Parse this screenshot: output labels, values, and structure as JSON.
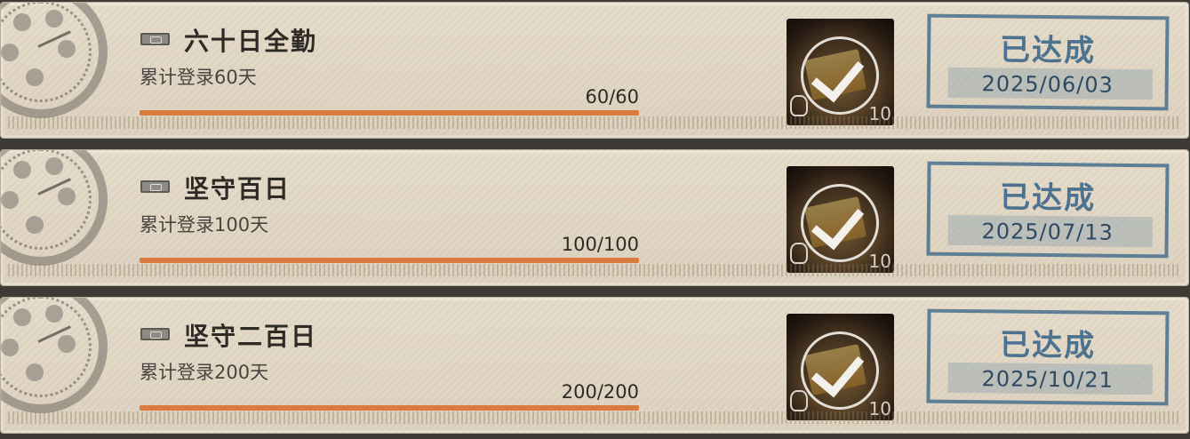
{
  "achievements": [
    {
      "title": "六十日全勤",
      "description": "累计登录60天",
      "progress_text": "60/60",
      "progress": 1.0,
      "reward_qty": "10",
      "status": "已达成",
      "date": "2025/06/03"
    },
    {
      "title": "坚守百日",
      "description": "累计登录100天",
      "progress_text": "100/100",
      "progress": 1.0,
      "reward_qty": "10",
      "status": "已达成",
      "date": "2025/07/13"
    },
    {
      "title": "坚守二百日",
      "description": "累计登录200天",
      "progress_text": "200/200",
      "progress": 1.0,
      "reward_qty": "10",
      "status": "已达成",
      "date": "2025/10/21"
    }
  ],
  "icons": {
    "badge": "clock-emblem-icon",
    "ticket": "ticket-icon",
    "reward": "chest-reward-icon",
    "claimed": "checkmark-icon",
    "pot": "pot-icon"
  },
  "colors": {
    "progress_fill": "#d97a3e",
    "stamp": "#4d7290",
    "card_bg": "#e2d8c6"
  }
}
